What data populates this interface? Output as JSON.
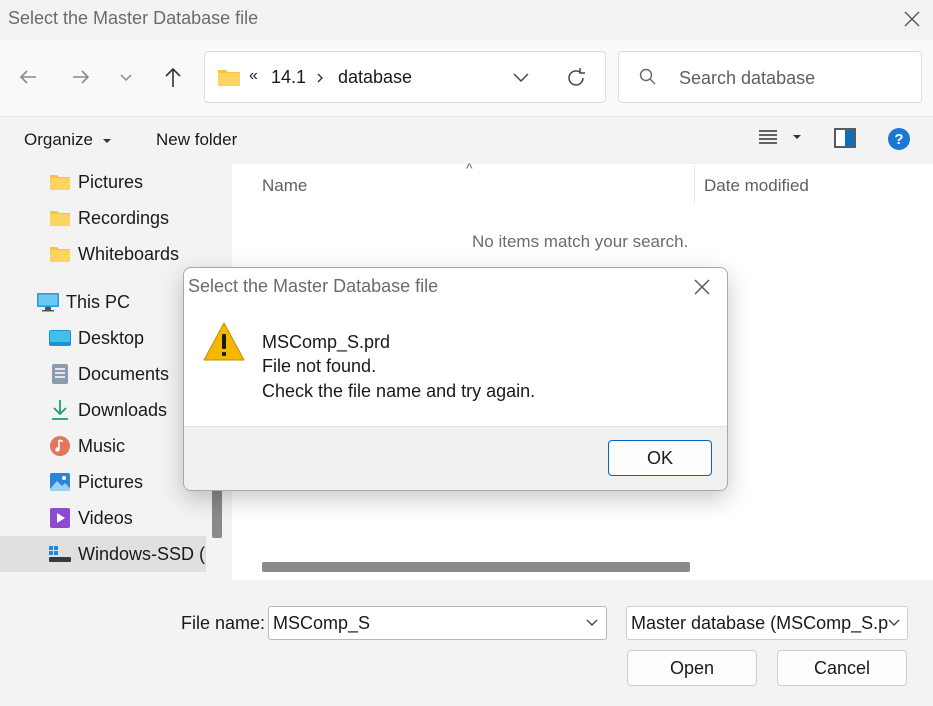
{
  "window": {
    "title": "Select the Master Database file"
  },
  "nav": {
    "breadcrumb_prefix": "«",
    "breadcrumb": [
      "14.1",
      "database"
    ],
    "search_placeholder": "Search database"
  },
  "commandbar": {
    "organize": "Organize",
    "new_folder": "New folder"
  },
  "sidebar": {
    "items": [
      {
        "label": "Pictures",
        "icon": "folder-icon"
      },
      {
        "label": "Recordings",
        "icon": "folder-icon"
      },
      {
        "label": "Whiteboards",
        "icon": "folder-icon"
      },
      {
        "label": "This PC",
        "icon": "computer-icon"
      },
      {
        "label": "Desktop",
        "icon": "desktop-icon"
      },
      {
        "label": "Documents",
        "icon": "documents-icon"
      },
      {
        "label": "Downloads",
        "icon": "download-icon"
      },
      {
        "label": "Music",
        "icon": "music-icon"
      },
      {
        "label": "Pictures",
        "icon": "pictures-icon"
      },
      {
        "label": "Videos",
        "icon": "videos-icon"
      },
      {
        "label": "Windows-SSD (C",
        "icon": "drive-icon"
      }
    ]
  },
  "content": {
    "columns": [
      "Name",
      "Date modified"
    ],
    "empty_message": "No items match your search."
  },
  "footer": {
    "file_name_label": "File name:",
    "file_name_value": "MSComp_S",
    "file_type_value": "Master database (MSComp_S.p",
    "open": "Open",
    "cancel": "Cancel"
  },
  "dialog": {
    "title": "Select the Master Database file",
    "lines": [
      "MSComp_S.prd",
      "File not found.",
      "Check the file name and try again."
    ],
    "ok": "OK"
  },
  "colors": {
    "accent": "#0067c0",
    "folder": "#f8c53a",
    "warning": "#f5b800"
  }
}
